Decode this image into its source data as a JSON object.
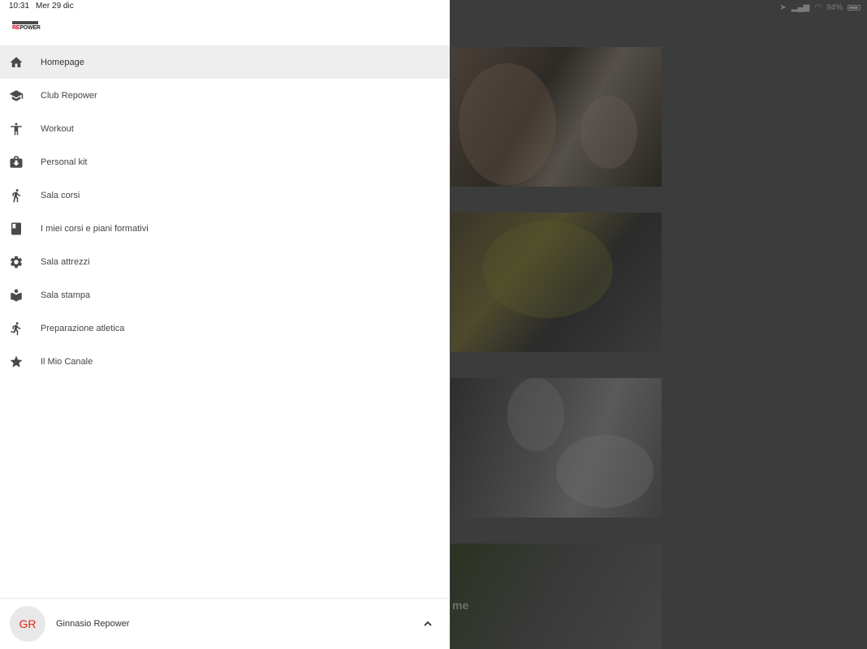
{
  "status_bar": {
    "time": "10:31",
    "date": "Mer 29 dic",
    "battery": "94%"
  },
  "logo": {
    "text_red": "RE",
    "text_dark": "POWER"
  },
  "menu": {
    "items": [
      {
        "label": "Homepage",
        "icon": "home-icon"
      },
      {
        "label": "Club Repower",
        "icon": "school-icon"
      },
      {
        "label": "Workout",
        "icon": "accessibility-icon"
      },
      {
        "label": "Personal kit",
        "icon": "briefcase-download-icon"
      },
      {
        "label": "Sala corsi",
        "icon": "walk-icon"
      },
      {
        "label": "I miei corsi e piani formativi",
        "icon": "book-icon"
      },
      {
        "label": "Sala attrezzi",
        "icon": "gear-icon"
      },
      {
        "label": "Sala stampa",
        "icon": "reading-icon"
      },
      {
        "label": "Preparazione atletica",
        "icon": "run-icon"
      },
      {
        "label": "Il Mio Canale",
        "icon": "star-icon"
      }
    ],
    "active_index": 0
  },
  "user": {
    "initials": "GR",
    "name": "Ginnasio Repower"
  },
  "background": {
    "card4_partial_text": "me"
  },
  "colors": {
    "accent": "#e2231a",
    "active_row": "#eeeeee",
    "icon": "#4a4a4a"
  }
}
